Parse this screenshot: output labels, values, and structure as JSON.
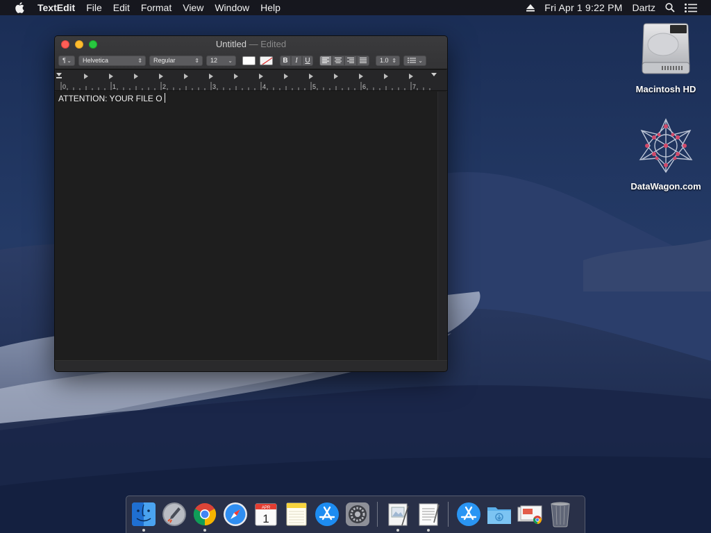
{
  "menubar": {
    "app_name": "TextEdit",
    "menus": [
      "File",
      "Edit",
      "Format",
      "View",
      "Window",
      "Help"
    ],
    "clock": "Fri Apr 1  9:22 PM",
    "user": "Dartz"
  },
  "desktop": {
    "icons": [
      {
        "label": "Macintosh HD"
      },
      {
        "label": "DataWagon.com"
      }
    ]
  },
  "window": {
    "title": "Untitled",
    "edited_suffix": "— Edited",
    "toolbar": {
      "paragraph_style": "¶",
      "font_family": "Helvetica",
      "font_style": "Regular",
      "font_size": "12",
      "bold": "B",
      "italic": "I",
      "underline": "U",
      "line_spacing": "1.0",
      "active_alignment": "left",
      "text_color": "#ffffff",
      "background_color": "none"
    },
    "ruler": {
      "labels": [
        "0",
        "1",
        "2",
        "3",
        "4",
        "5",
        "6",
        "7"
      ]
    },
    "document_text": "ATTENTION: YOUR FILE O"
  },
  "dock": {
    "apps": [
      {
        "name": "finder-icon",
        "running": true
      },
      {
        "name": "launchpad-icon",
        "running": false
      },
      {
        "name": "chrome-icon",
        "running": true
      },
      {
        "name": "safari-icon",
        "running": false
      },
      {
        "name": "calendar-icon",
        "running": false,
        "month": "APR",
        "day": "1"
      },
      {
        "name": "notes-icon",
        "running": false
      },
      {
        "name": "app-store-icon",
        "running": false
      },
      {
        "name": "system-preferences-icon",
        "running": false
      },
      {
        "name": "preview-icon",
        "running": true
      },
      {
        "name": "textedit-icon",
        "running": true
      },
      {
        "name": "app-store-downloads-icon",
        "running": false
      },
      {
        "name": "downloads-folder-icon",
        "running": false
      },
      {
        "name": "documents-stack-icon",
        "running": false
      },
      {
        "name": "trash-icon",
        "running": false
      }
    ]
  },
  "colors": {
    "menubar_bg": "#16161a",
    "window_bg": "#1e1e1e",
    "accent_close": "#fe5f57",
    "accent_min": "#febc2e",
    "accent_zoom": "#28c840"
  }
}
